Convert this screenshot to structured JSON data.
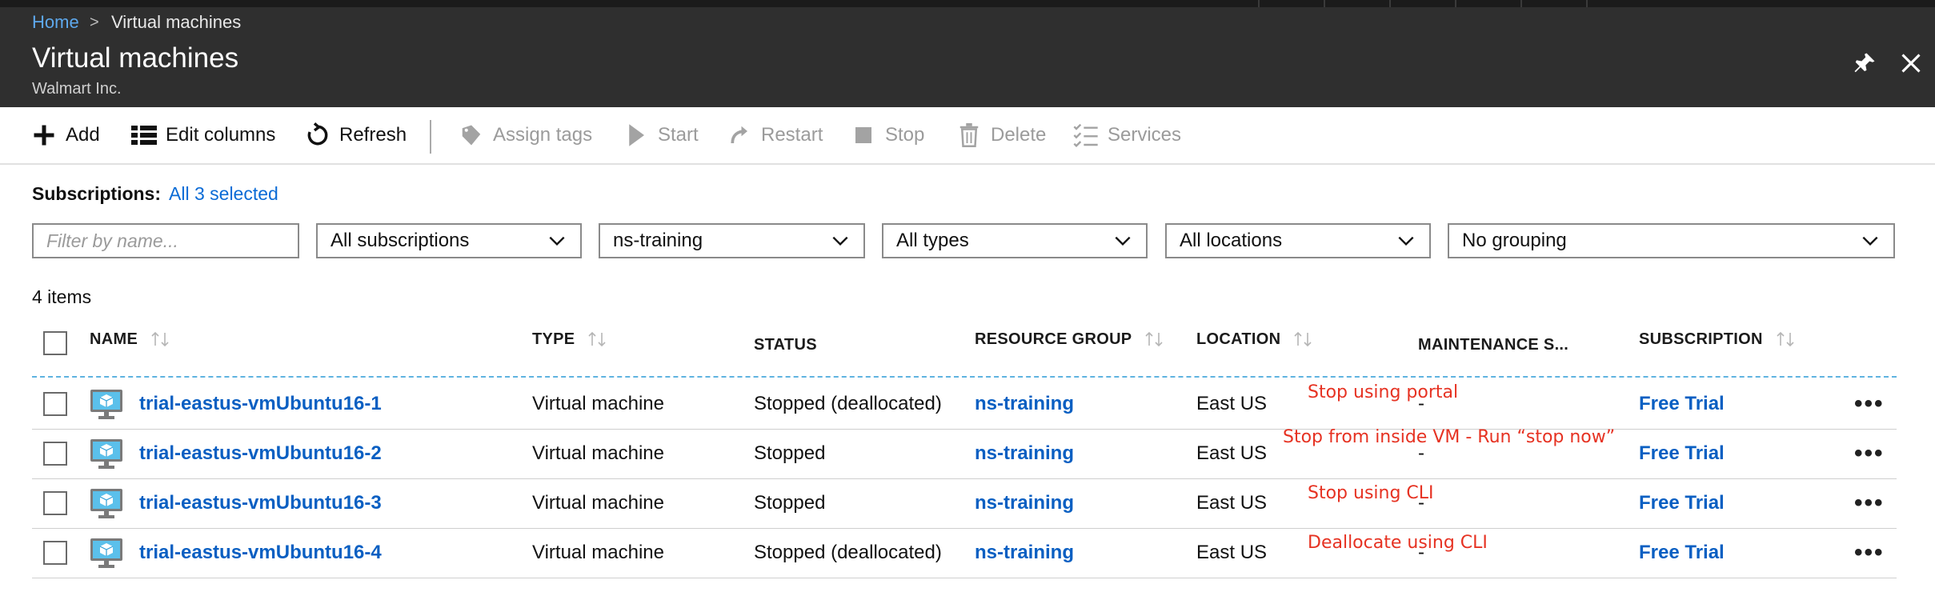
{
  "breadcrumb": {
    "home": "Home",
    "separator": ">",
    "current": "Virtual machines"
  },
  "header": {
    "title": "Virtual machines",
    "subtitle": "Walmart Inc.",
    "pin_icon": "pin-icon",
    "close_icon": "close-icon"
  },
  "toolbar": {
    "add": "Add",
    "edit_columns": "Edit columns",
    "refresh": "Refresh",
    "assign_tags": "Assign tags",
    "start": "Start",
    "restart": "Restart",
    "stop": "Stop",
    "delete": "Delete",
    "services": "Services"
  },
  "subscriptions": {
    "label": "Subscriptions:",
    "value": "All 3 selected"
  },
  "filters": {
    "name_placeholder": "Filter by name...",
    "subscriptions": "All subscriptions",
    "resource_group": "ns-training",
    "types": "All types",
    "locations": "All locations",
    "grouping": "No grouping"
  },
  "items_count": "4 items",
  "columns": {
    "name": "NAME",
    "type": "TYPE",
    "status": "STATUS",
    "resource_group": "RESOURCE GROUP",
    "location": "LOCATION",
    "maintenance": "MAINTENANCE S...",
    "subscription": "SUBSCRIPTION"
  },
  "rows": [
    {
      "name": "trial-eastus-vmUbuntu16-1",
      "type": "Virtual machine",
      "status": "Stopped (deallocated)",
      "resource_group": "ns-training",
      "location": "East US",
      "maintenance": "-",
      "subscription": "Free Trial",
      "more": "•••"
    },
    {
      "name": "trial-eastus-vmUbuntu16-2",
      "type": "Virtual machine",
      "status": "Stopped",
      "resource_group": "ns-training",
      "location": "East US",
      "maintenance": "-",
      "subscription": "Free Trial",
      "more": "•••"
    },
    {
      "name": "trial-eastus-vmUbuntu16-3",
      "type": "Virtual machine",
      "status": "Stopped",
      "resource_group": "ns-training",
      "location": "East US",
      "maintenance": "-",
      "subscription": "Free Trial",
      "more": "•••"
    },
    {
      "name": "trial-eastus-vmUbuntu16-4",
      "type": "Virtual machine",
      "status": "Stopped (deallocated)",
      "resource_group": "ns-training",
      "location": "East US",
      "maintenance": "-",
      "subscription": "Free Trial",
      "more": "•••"
    }
  ],
  "annotations": [
    "Stop using portal",
    "Stop from inside VM - Run “stop now”",
    "Stop using CLI",
    "Deallocate using CLI"
  ],
  "colors": {
    "link": "#0a5fc2",
    "annotation": "#e63222",
    "header_bg": "#2f2f2f",
    "accent": "#5fb3e0"
  }
}
